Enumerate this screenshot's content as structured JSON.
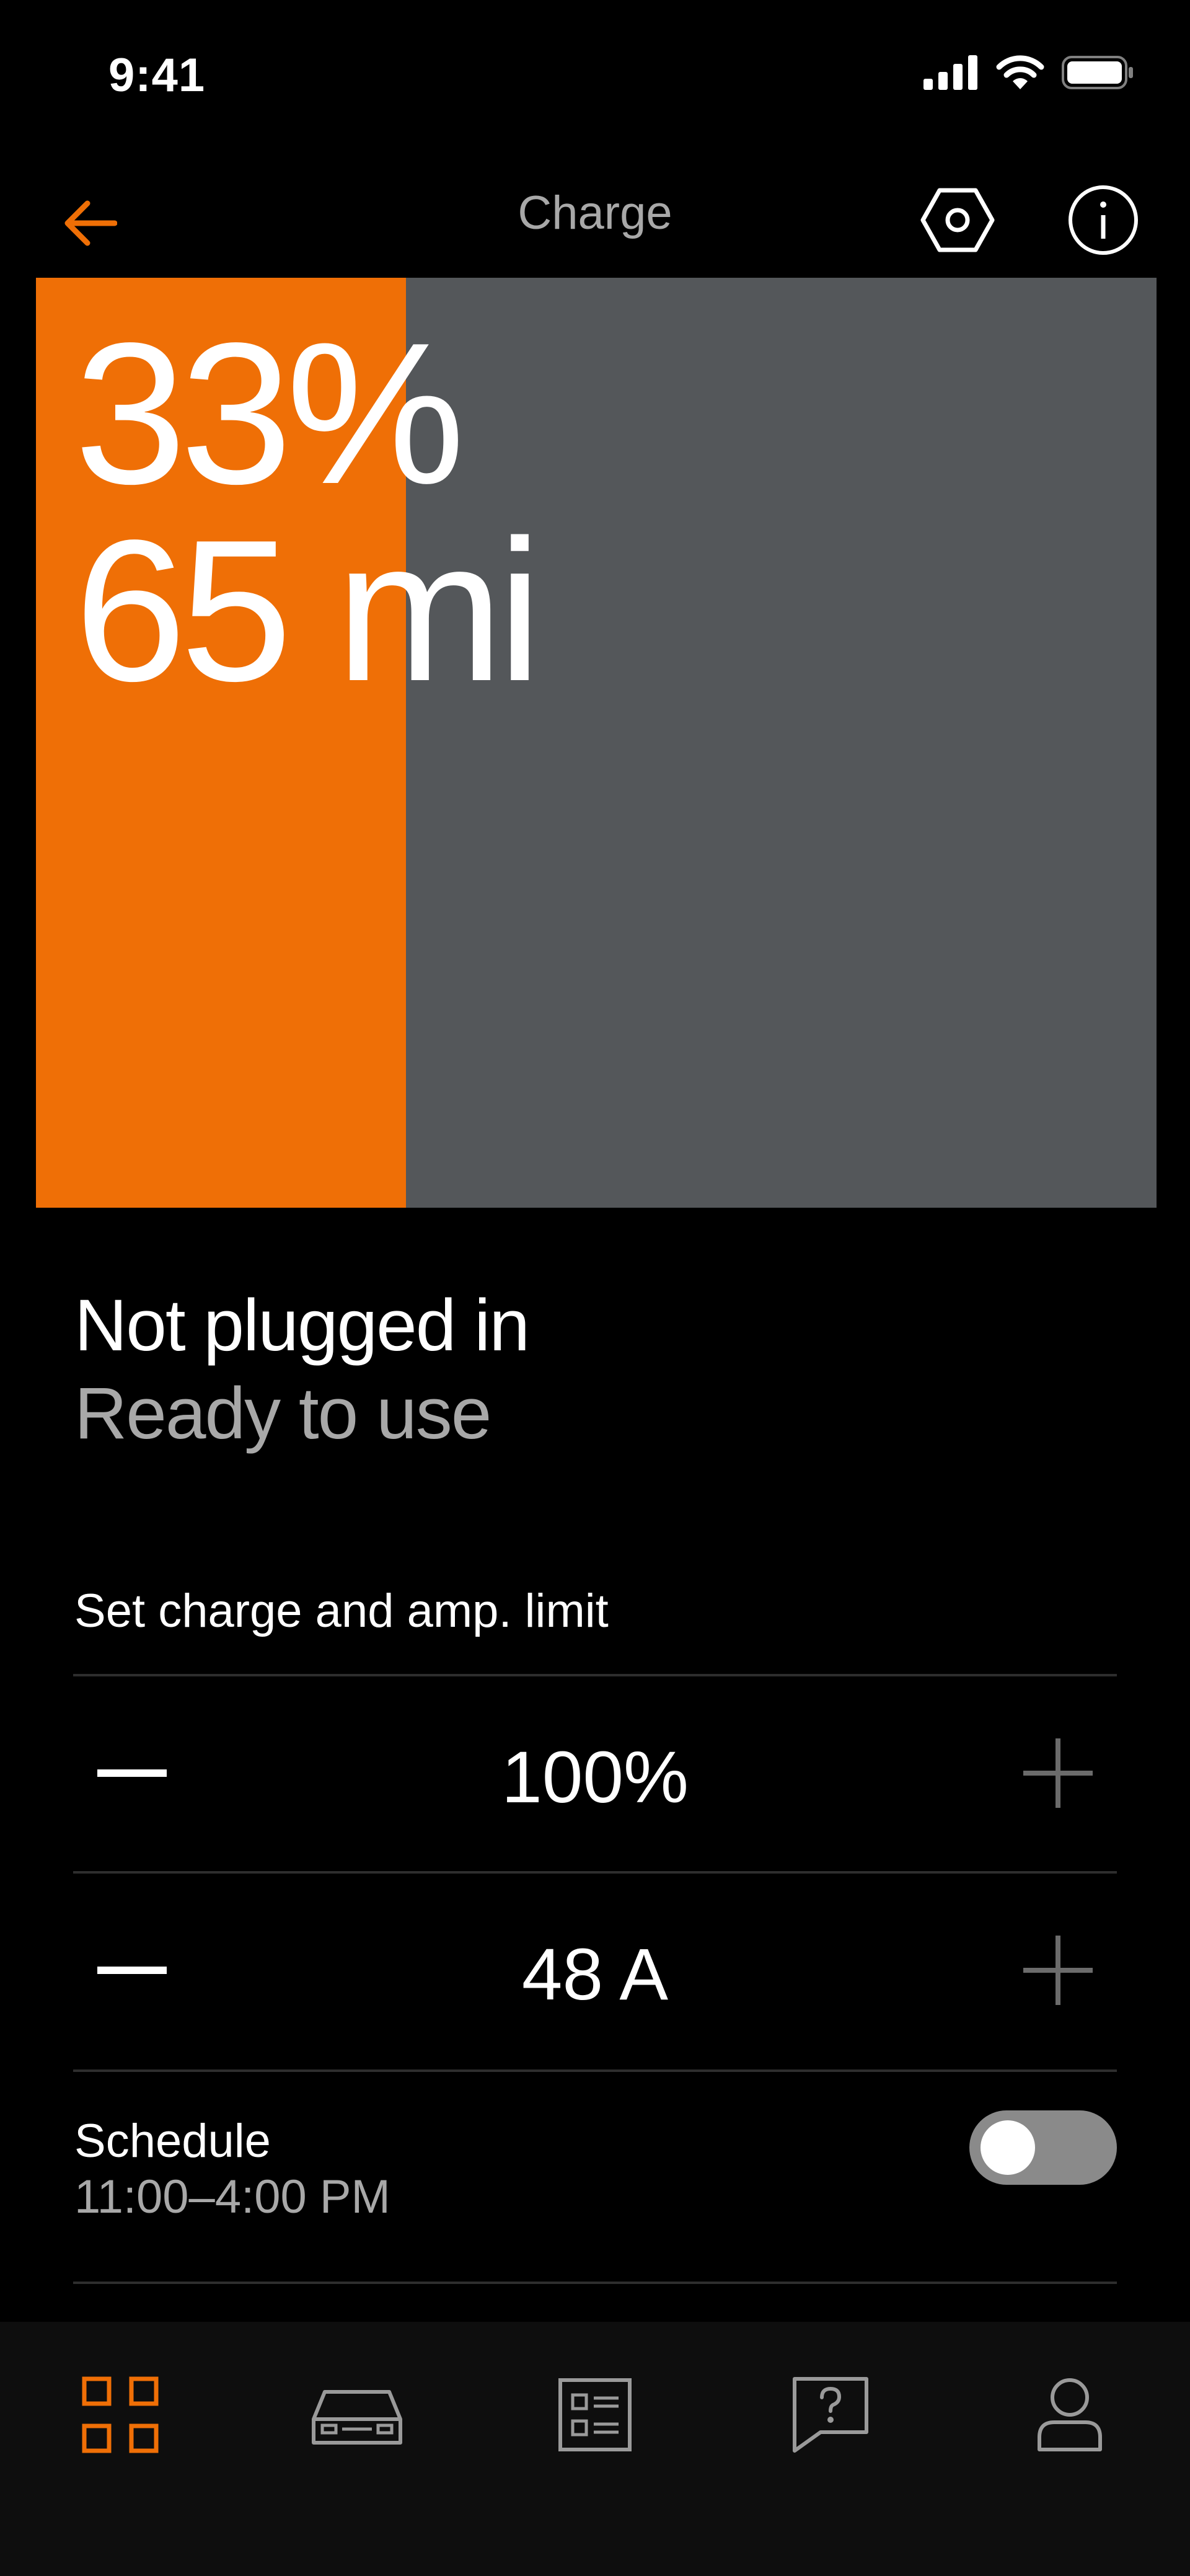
{
  "status_bar": {
    "time": "9:41",
    "icons": [
      "cellular-signal-icon",
      "wifi-icon",
      "battery-icon"
    ]
  },
  "header": {
    "title": "Charge",
    "back_icon": "arrow-left-icon",
    "settings_icon": "hexagon-settings-icon",
    "info_icon": "info-icon"
  },
  "battery": {
    "level_fraction": 0.33,
    "percent_label": "33%",
    "range_label": "65 mi"
  },
  "status": {
    "plug_status": "Not plugged in",
    "ready_status": "Ready to use"
  },
  "limits": {
    "title": "Set charge and amp. limit",
    "charge_limit": {
      "value": "100%",
      "minus_icon": "minus-icon",
      "plus_icon": "plus-icon"
    },
    "amp_limit": {
      "value": "48 A",
      "minus_icon": "minus-icon",
      "plus_icon": "plus-icon"
    }
  },
  "schedule": {
    "label": "Schedule",
    "time_range": "11:00–4:00 PM",
    "enabled": false
  },
  "tab_bar": {
    "tabs": [
      {
        "icon": "grid-icon",
        "active": true
      },
      {
        "icon": "car-icon",
        "active": false
      },
      {
        "icon": "checklist-icon",
        "active": false
      },
      {
        "icon": "help-chat-icon",
        "active": false
      },
      {
        "icon": "profile-icon",
        "active": false
      }
    ]
  },
  "colors": {
    "accent": "#ef6f06",
    "panel_gray": "#54575a",
    "background": "#000000",
    "secondary_text": "#a8a8a8"
  }
}
